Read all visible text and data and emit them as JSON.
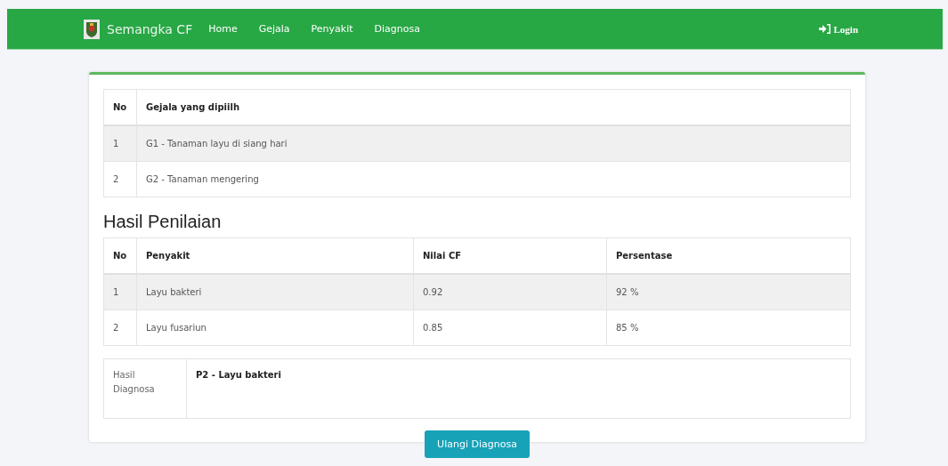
{
  "navbar": {
    "brand": "Semangka CF",
    "links": [
      "Home",
      "Gejala",
      "Penyakit",
      "Diagnosa"
    ],
    "login": "Login"
  },
  "symptoms_table": {
    "columns": [
      "No",
      "Gejala yang dipiilh"
    ],
    "rows": [
      [
        "1",
        "G1 - Tanaman layu di siang hari"
      ],
      [
        "2",
        "G2 - Tanaman mengering"
      ]
    ]
  },
  "results_heading": "Hasil Penilaian",
  "results_table": {
    "columns": [
      "No",
      "Penyakit",
      "Nilai CF",
      "Persentase"
    ],
    "rows": [
      [
        "1",
        "Layu bakteri",
        "0.92",
        "92 %"
      ],
      [
        "2",
        "Layu fusariun",
        "0.85",
        "85 %"
      ]
    ]
  },
  "diagnosis": {
    "label": "Hasil Diagnosa",
    "value": "P2 - Layu bakteri"
  },
  "button": "Ulangi Diagnosa"
}
